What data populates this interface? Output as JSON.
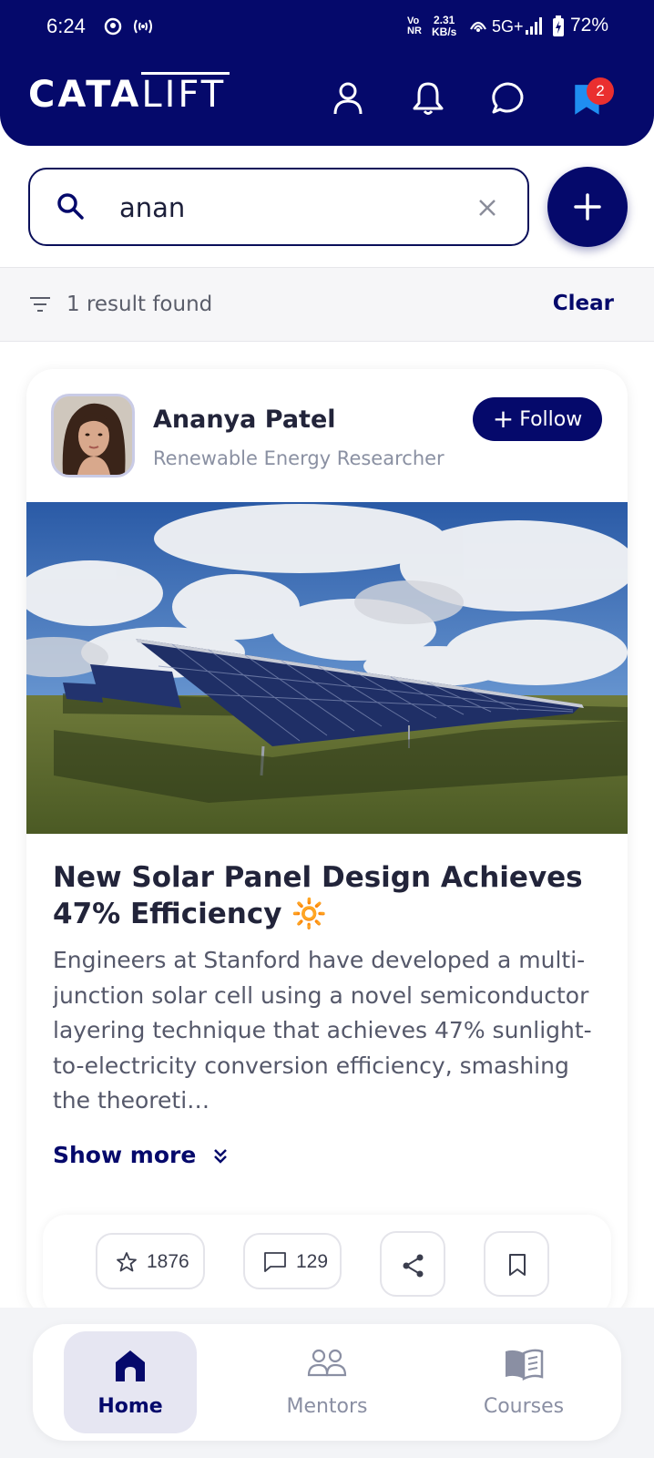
{
  "status_bar": {
    "time": "6:24",
    "net_top": "2.31",
    "net_bottom": "KB/s",
    "network": "5G+",
    "battery": "72%"
  },
  "header": {
    "logo_bold": "CATA",
    "logo_light": "LIFT",
    "notification_badge": "2"
  },
  "search": {
    "value": "anan",
    "placeholder": ""
  },
  "results": {
    "count_text": "1 result found",
    "clear_label": "Clear"
  },
  "post": {
    "author_name": "Ananya Patel",
    "author_role": "Renewable Energy Researcher",
    "follow_label": "Follow",
    "title": "New Solar Panel Design Achieves 47% Efficiency",
    "title_emoji": "🔆",
    "body": "Engineers at Stanford have developed a multi-junction solar cell using a novel semiconductor layering technique that achieves 47% sunlight-to-electricity conversion efficiency, smashing the theoreti…",
    "show_more_label": "Show more",
    "stars": "1876",
    "comments": "129"
  },
  "bottom_nav": {
    "items": [
      {
        "label": "Home",
        "icon": "home-icon",
        "active": true
      },
      {
        "label": "Mentors",
        "icon": "mentors-icon",
        "active": false
      },
      {
        "label": "Courses",
        "icon": "book-icon",
        "active": false
      }
    ]
  },
  "colors": {
    "primary": "#05096b",
    "badge": "#ea2f2f",
    "muted": "#8a90a2"
  }
}
